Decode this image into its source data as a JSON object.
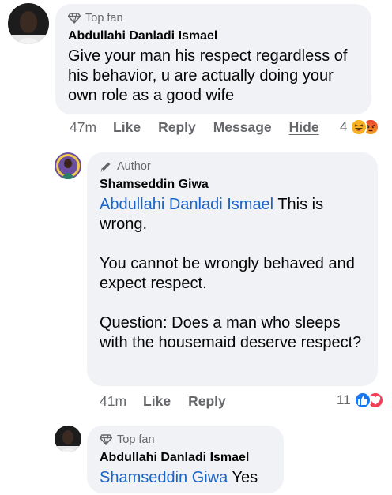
{
  "comment1": {
    "badge": "Top fan",
    "author": "Abdullahi Danladi Ismael",
    "text": "Give your man his respect regardless of his behavior, u are actually doing your own role as a good wife",
    "time": "47m",
    "actions": {
      "like": "Like",
      "reply": "Reply",
      "message": "Message",
      "hide": "Hide"
    },
    "reaction_count": "4",
    "reaction_icons": [
      "haha-icon",
      "angry-icon"
    ]
  },
  "comment2": {
    "badge": "Author",
    "author": "Shamseddin Giwa",
    "mention": "Abdullahi Danladi Ismael",
    "text_line1": " This is wrong.",
    "paragraph2": "You cannot be wrongly behaved and expect respect.",
    "paragraph3": "Question: Does a man who sleeps with the housemaid deserve respect?",
    "time": "41m",
    "actions": {
      "like": "Like",
      "reply": "Reply"
    },
    "reaction_count": "11",
    "reaction_icons": [
      "like-icon",
      "love-icon"
    ]
  },
  "comment3": {
    "badge": "Top fan",
    "author": "Abdullahi Danladi Ismael",
    "mention": "Shamseddin Giwa",
    "text": " Yes"
  },
  "colors": {
    "bubble": "#f0f2f5",
    "mention": "#1a64c7",
    "meta": "#65676b",
    "like_blue": "#1877f2",
    "love_red": "#f33e58"
  }
}
